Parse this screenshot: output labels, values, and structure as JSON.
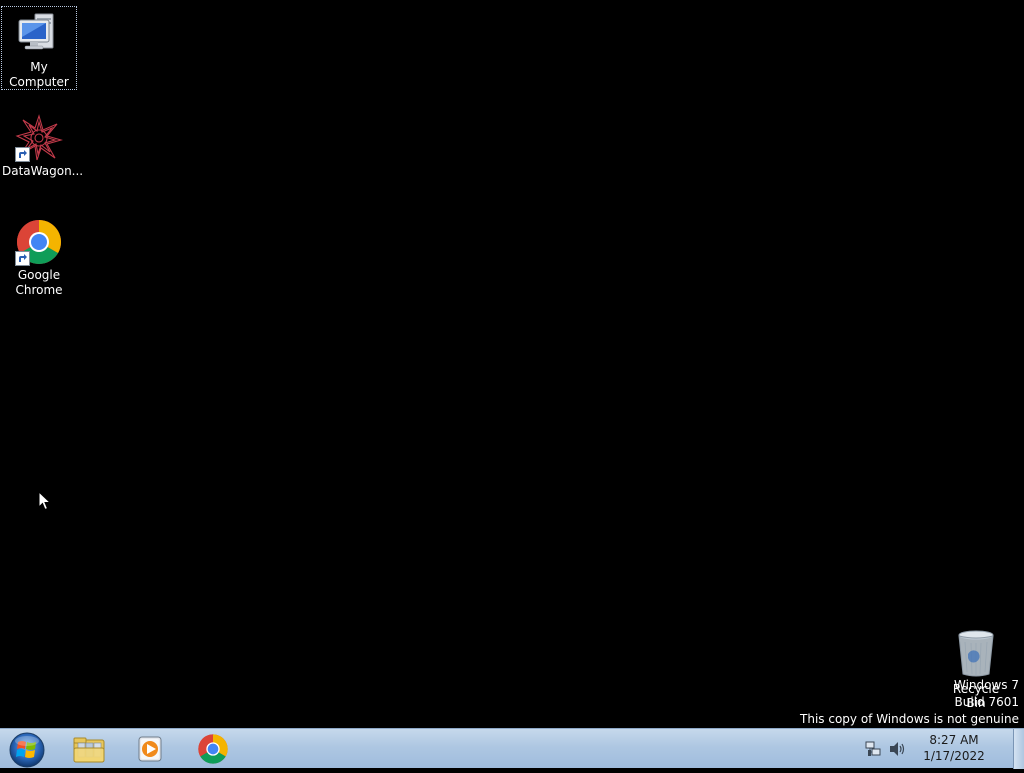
{
  "desktop": {
    "icons": [
      {
        "label": "My Computer",
        "icon": "computer-icon",
        "selected": true
      },
      {
        "label": "DataWagon...",
        "icon": "datawagon-icon",
        "shortcut": true
      },
      {
        "label": "Google Chrome",
        "icon": "chrome-icon",
        "shortcut": true
      }
    ],
    "recycle_bin": {
      "label": "Recycle Bin",
      "icon": "recycle-bin-icon"
    },
    "watermark": {
      "line1": "Windows 7",
      "line2": "Build 7601",
      "line3": "This copy of Windows is not genuine"
    }
  },
  "taskbar": {
    "start_icon": "windows-logo-icon",
    "pinned": [
      {
        "name": "Windows Explorer",
        "icon": "folder-library-icon"
      },
      {
        "name": "Windows Media Player",
        "icon": "media-player-icon"
      },
      {
        "name": "Google Chrome",
        "icon": "chrome-icon"
      }
    ],
    "tray": {
      "icons": [
        "network-icon",
        "volume-icon"
      ],
      "time": "8:27 AM",
      "date": "1/17/2022"
    }
  },
  "colors": {
    "desktop_bg": "#000000",
    "taskbar_top": "#c6d9ec",
    "taskbar_bottom": "#9fbcdd"
  }
}
